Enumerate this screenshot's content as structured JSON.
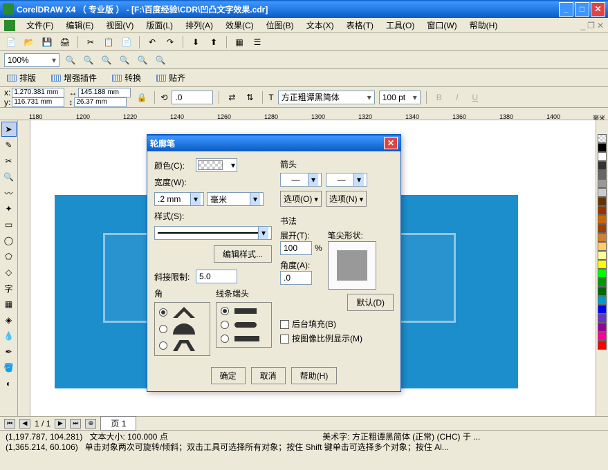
{
  "titlebar": {
    "app": "CorelDRAW X4 （ 专业版 ）",
    "doc_path": " - [F:\\百度经验\\CDR\\凹凸文字效果.cdr]"
  },
  "menubar": {
    "items": [
      "文件(F)",
      "编辑(E)",
      "视图(V)",
      "版面(L)",
      "排列(A)",
      "效果(C)",
      "位图(B)",
      "文本(X)",
      "表格(T)",
      "工具(O)",
      "窗口(W)",
      "帮助(H)"
    ]
  },
  "zoom": {
    "value": "100%"
  },
  "tabbar": {
    "items": [
      "排版",
      "增强插件",
      "转换",
      "贴齐"
    ]
  },
  "props": {
    "x": "1,270.381 mm",
    "y": "116.731 mm",
    "w": "145.188 mm",
    "h": "26.37 mm",
    "rotate": ".0",
    "font": "方正粗谭黑简体",
    "size": "100 pt"
  },
  "ruler_ticks": [
    "1180",
    "1200",
    "1220",
    "1240",
    "1260",
    "1280",
    "1300",
    "1320",
    "1340",
    "1360",
    "1380",
    "1400"
  ],
  "ruler_unit": "毫米",
  "colors": [
    "#000000",
    "#ffffff",
    "#333333",
    "#666666",
    "#999999",
    "#cccccc",
    "#663300",
    "#993300",
    "#cc6600",
    "#a04000",
    "#d08030",
    "#ffcc66",
    "#ffff99",
    "#ffff00",
    "#00ff00",
    "#009900",
    "#006600",
    "#0099cc",
    "#0000ff",
    "#6633cc",
    "#990099",
    "#ff0099",
    "#ff0000"
  ],
  "page_nav": {
    "counter": "1 / 1",
    "tab": "页 1"
  },
  "status": {
    "coord1": "(1,197.787, 104.281)",
    "text_info": "文本大小: 100.000 点",
    "art_text": "美术字: 方正粗谭黑简体 (正常) (CHC) 于 ...",
    "coord2": "(1,365.214, 60.106)",
    "hint": "单击对象两次可旋转/倾斜；双击工具可选择所有对象；按住 Shift 键单击可选择多个对象；按住 Al..."
  },
  "dialog": {
    "title": "轮廓笔",
    "color_label": "颜色(C):",
    "width_label": "宽度(W):",
    "width_value": ".2 mm",
    "width_unit": "毫米",
    "style_label": "样式(S):",
    "edit_style": "编辑样式...",
    "miter_label": "斜接限制:",
    "miter_value": "5.0",
    "corners_label": "角",
    "caps_label": "线条端头",
    "arrow_label": "箭头",
    "options_left": "选项(O)",
    "options_right": "选项(N)",
    "calligraphy_label": "书法",
    "stretch_label": "展开(T):",
    "stretch_value": "100",
    "percent": "%",
    "angle_label": "角度(A):",
    "angle_value": ".0",
    "nib_label": "笔尖形状:",
    "default_btn": "默认(D)",
    "behind_fill": "后台填充(B)",
    "scale_with": "按图像比例显示(M)",
    "ok": "确定",
    "cancel": "取消",
    "help": "帮助(H)"
  }
}
